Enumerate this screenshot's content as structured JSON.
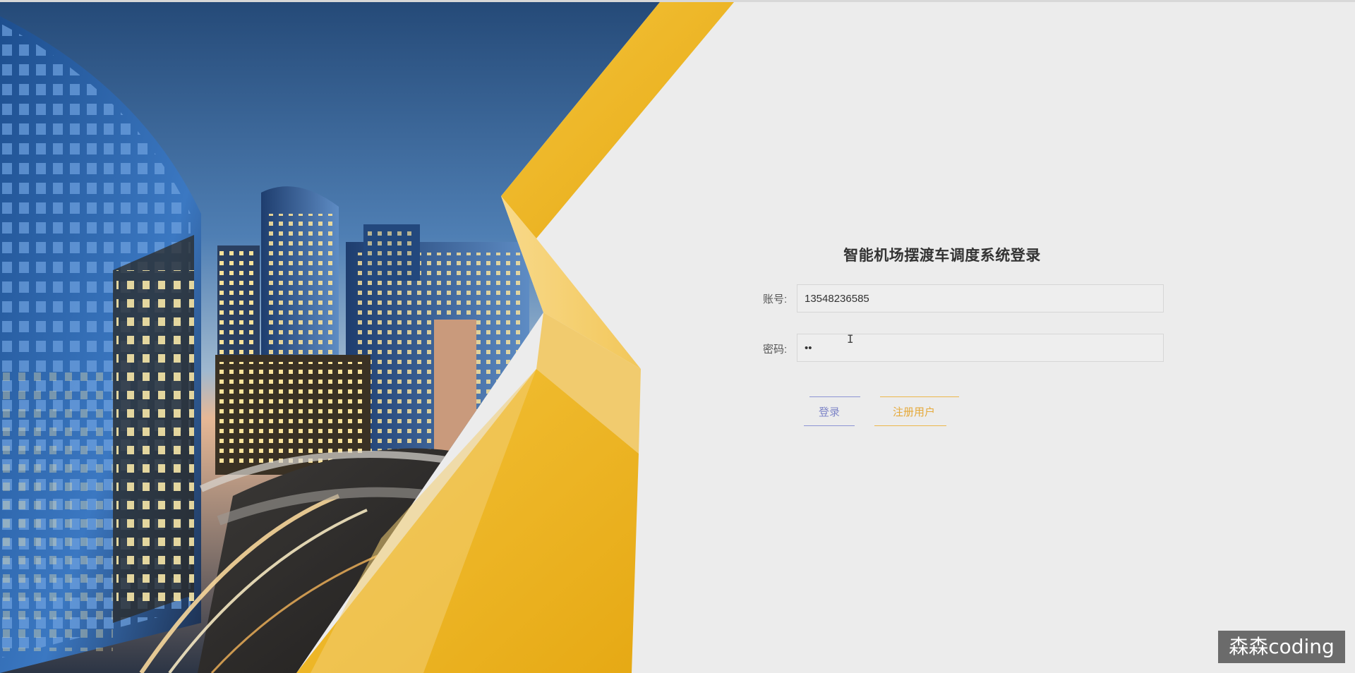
{
  "login": {
    "title": "智能机场摆渡车调度系统登录",
    "account_label": "账号:",
    "account_value": "13548236585",
    "password_label": "密码:",
    "password_value": "••",
    "login_button": "登录",
    "register_button": "注册用户"
  },
  "watermark": "森森coding",
  "colors": {
    "background": "#ececec",
    "accent_yellow": "#f0b824",
    "login_accent": "#7f86c8",
    "register_accent": "#e5a93a"
  }
}
